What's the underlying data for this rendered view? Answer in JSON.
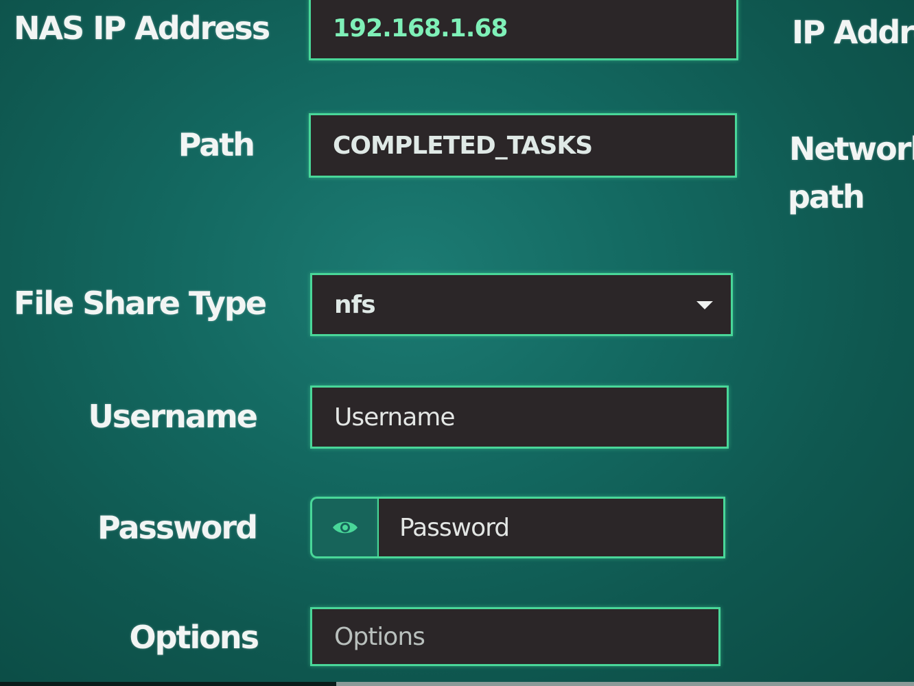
{
  "form": {
    "nas_ip": {
      "label": "NAS IP Address",
      "value": "192.168.1.68"
    },
    "path": {
      "label": "Path",
      "value": "COMPLETED_TASKS"
    },
    "file_share_type": {
      "label": "File Share Type",
      "selected": "nfs"
    },
    "username": {
      "label": "Username",
      "placeholder": "Username"
    },
    "password": {
      "label": "Password",
      "placeholder": "Password"
    },
    "options": {
      "label": "Options",
      "placeholder": "Options"
    }
  },
  "help": {
    "ip_hint": "IP Addres",
    "path_hint_line1": "Network",
    "path_hint_line2": "path"
  },
  "icons": {
    "dropdown": "chevron-down-icon",
    "password_toggle": "eye-icon"
  },
  "colors": {
    "accent_border": "#49d799",
    "ip_text": "#7ff0b8",
    "field_bg": "#2b2628",
    "panel_bg": "#136860"
  }
}
